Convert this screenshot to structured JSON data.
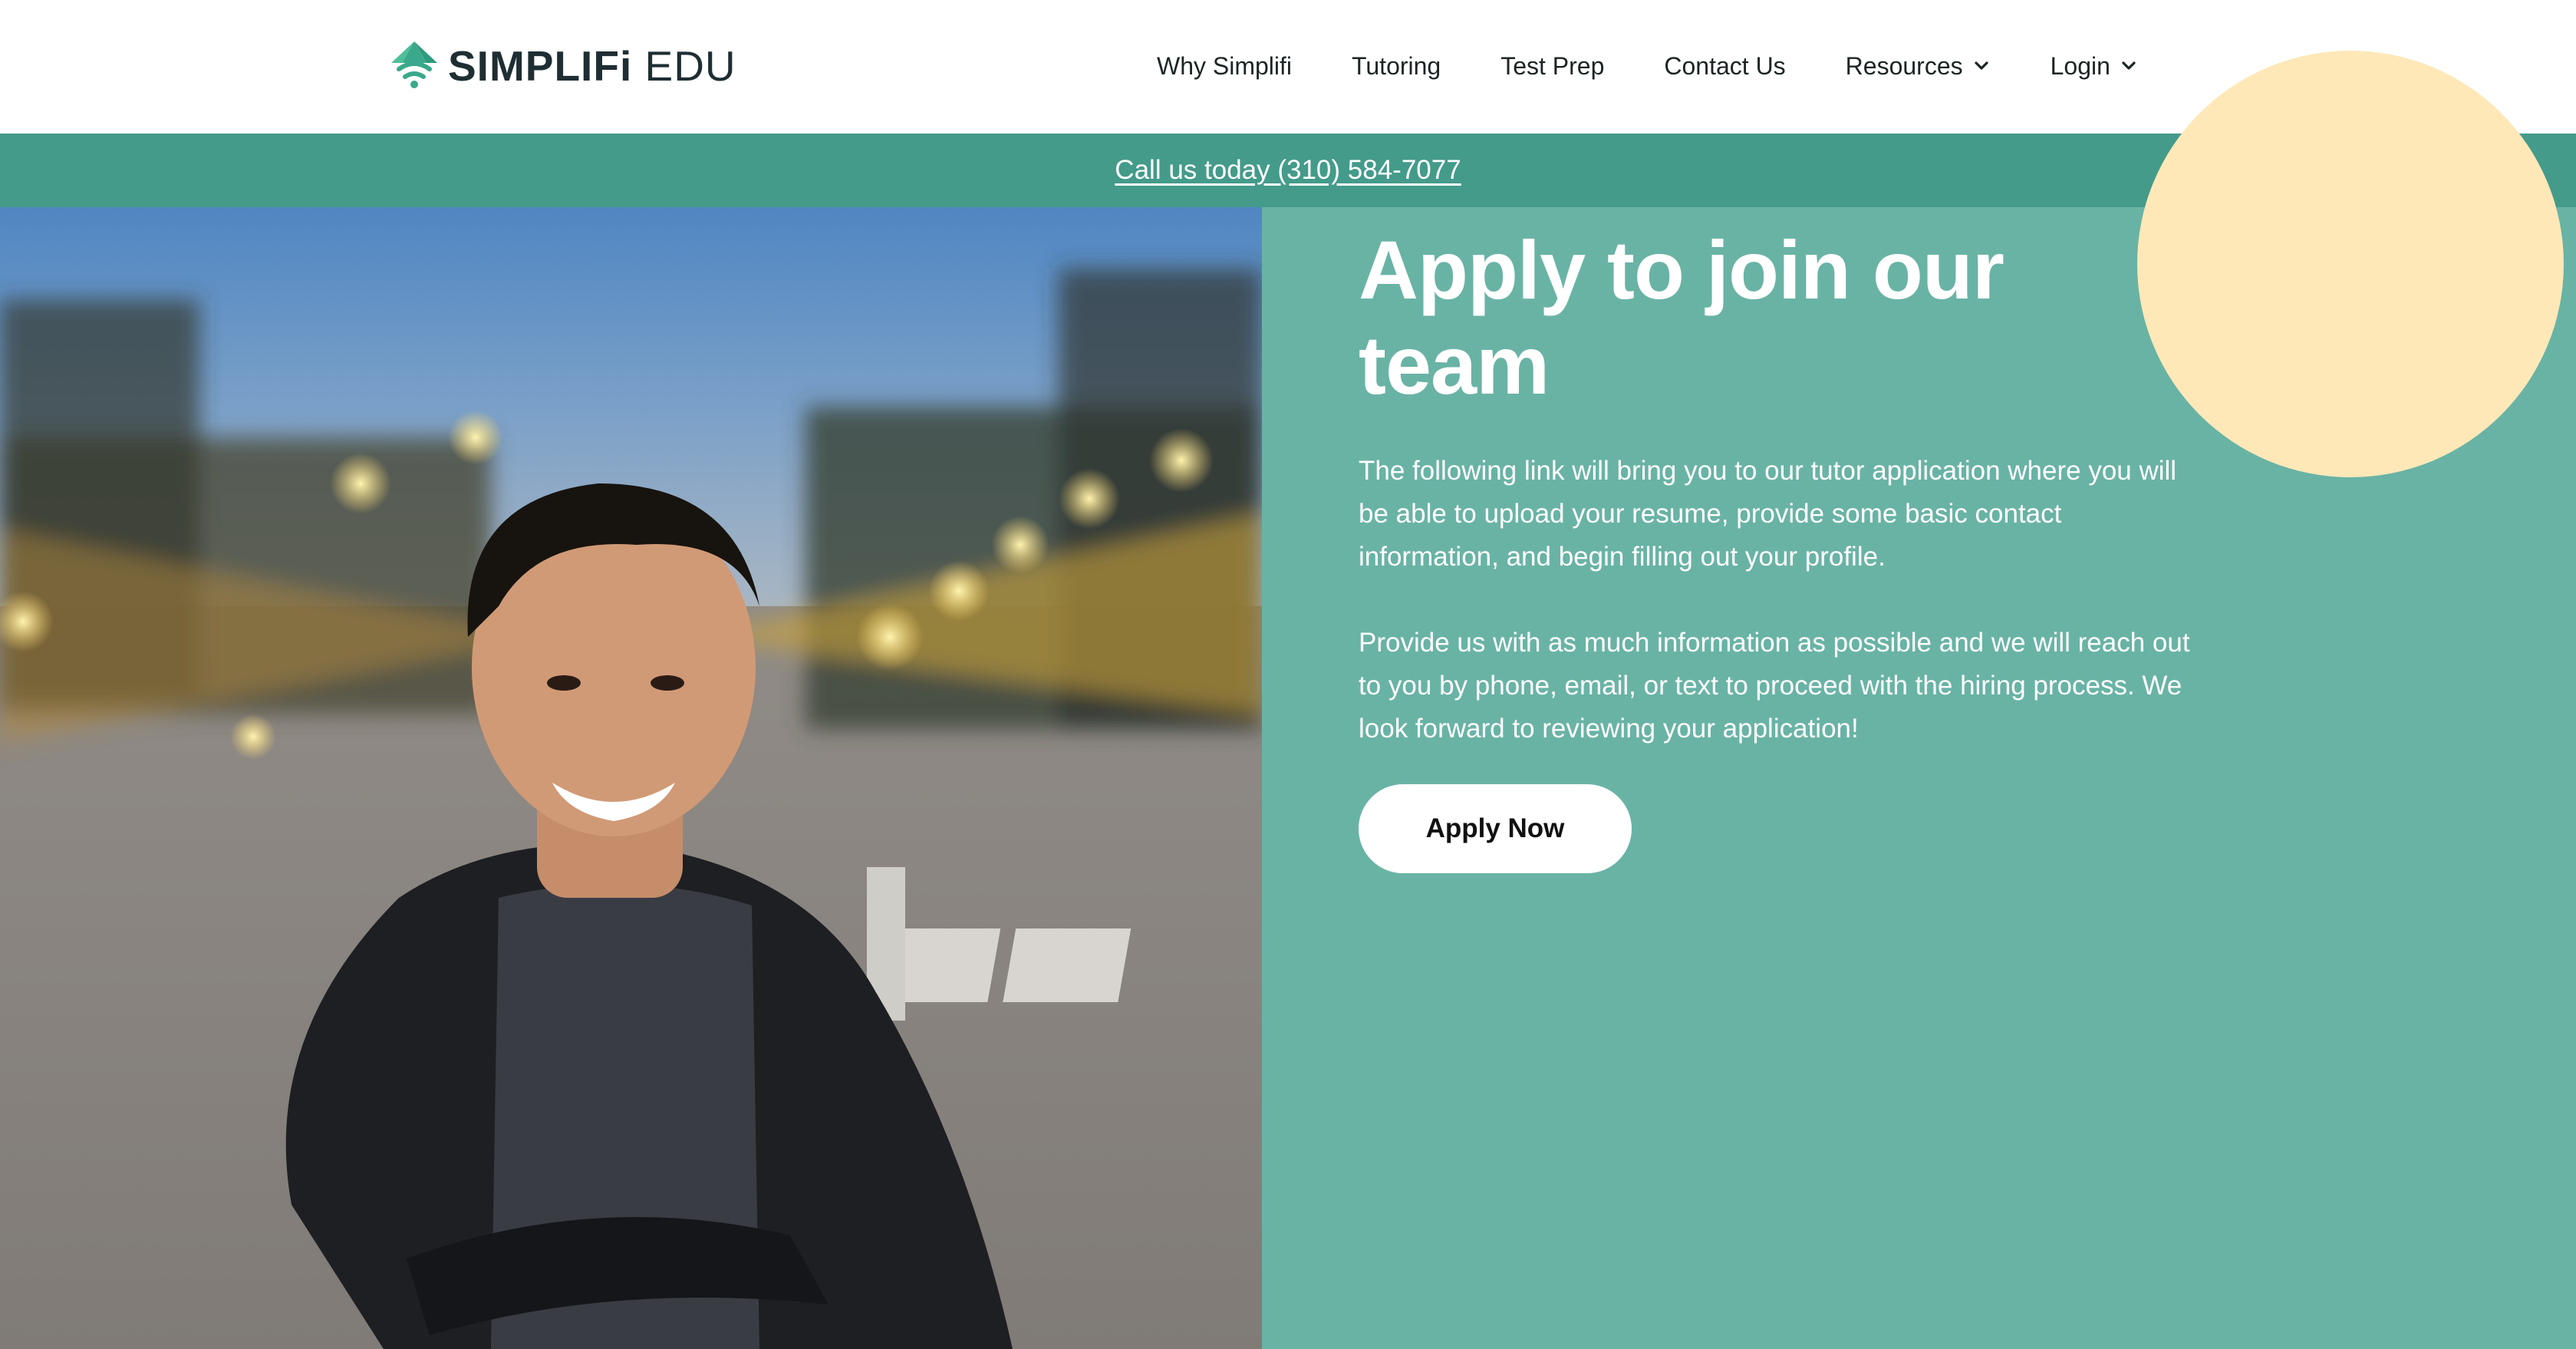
{
  "brand": {
    "name_bold": "SIMPLIFi",
    "name_light": " EDU",
    "logo_icon": "wifi-leaf-logo-icon",
    "colors": {
      "teal_dark": "#449b8a",
      "teal_panel": "#69b3a5",
      "sun": "#ffe8b8",
      "logo_green": "#3aa88a"
    }
  },
  "nav": {
    "items": [
      {
        "label": "Why Simplifi"
      },
      {
        "label": "Tutoring"
      },
      {
        "label": "Test Prep"
      },
      {
        "label": "Contact Us"
      },
      {
        "label": "Resources",
        "icon": "chevron-down-icon"
      },
      {
        "label": "Login",
        "icon": "chevron-down-icon"
      }
    ]
  },
  "callbar": {
    "text": "Call us today (310) 584-7077"
  },
  "hero": {
    "photo_alt": "Smiling man with crossed arms on a city street at dusk",
    "headline_line1": "Apply to join our",
    "headline_line2": "team",
    "paragraph1": "The following link will bring you to our tutor application where you will be able to upload your resume, provide some basic contact information, and begin filling out your profile.",
    "paragraph2": "Provide us with as much information as possible and we will reach out to you by phone, email, or text to proceed with the hiring process. We look forward to reviewing your application!",
    "cta_label": "Apply Now"
  }
}
